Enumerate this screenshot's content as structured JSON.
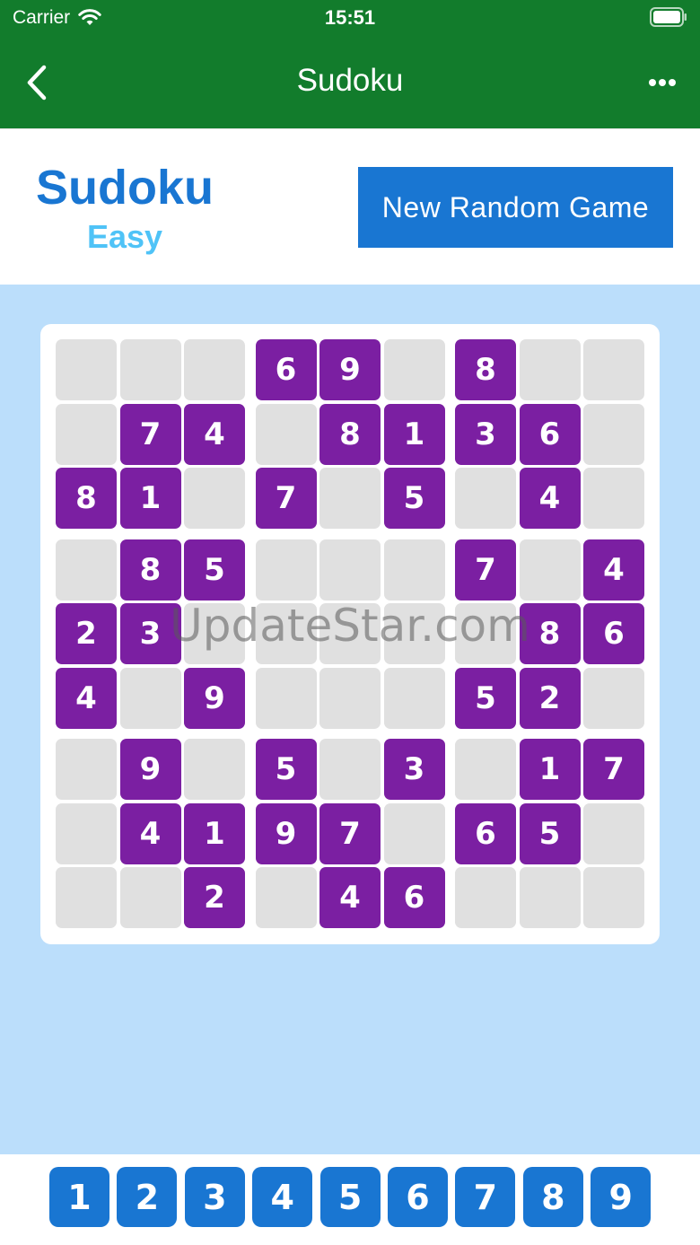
{
  "status_bar": {
    "carrier": "Carrier",
    "time": "15:51"
  },
  "nav": {
    "title": "Sudoku",
    "back_icon": "chevron-left-icon",
    "more_icon": "ellipsis-icon"
  },
  "game": {
    "title": "Sudoku",
    "difficulty": "Easy",
    "new_game_label": "New Random Game"
  },
  "board": {
    "rows": [
      [
        "",
        "",
        "",
        "6",
        "9",
        "",
        "8",
        "",
        ""
      ],
      [
        "",
        "7",
        "4",
        "",
        "8",
        "1",
        "3",
        "6",
        ""
      ],
      [
        "8",
        "1",
        "",
        "7",
        "",
        "5",
        "",
        "4",
        ""
      ],
      [
        "",
        "8",
        "5",
        "",
        "",
        "",
        "7",
        "",
        "4"
      ],
      [
        "2",
        "3",
        "",
        "",
        "",
        "",
        "",
        "8",
        "6"
      ],
      [
        "4",
        "",
        "9",
        "",
        "",
        "",
        "5",
        "2",
        ""
      ],
      [
        "",
        "9",
        "",
        "5",
        "",
        "3",
        "",
        "1",
        "7"
      ],
      [
        "",
        "4",
        "1",
        "9",
        "7",
        "",
        "6",
        "5",
        ""
      ],
      [
        "",
        "",
        "2",
        "",
        "4",
        "6",
        "",
        "",
        ""
      ]
    ]
  },
  "number_pad": [
    "1",
    "2",
    "3",
    "4",
    "5",
    "6",
    "7",
    "8",
    "9"
  ],
  "watermark": "UpdateStar.com",
  "colors": {
    "header": "#127c2c",
    "given_cell": "#7b1fa2",
    "empty_cell": "#e0e0e0",
    "accent": "#1976d2",
    "difficulty": "#4fc3f7",
    "background": "#bbdefb"
  }
}
